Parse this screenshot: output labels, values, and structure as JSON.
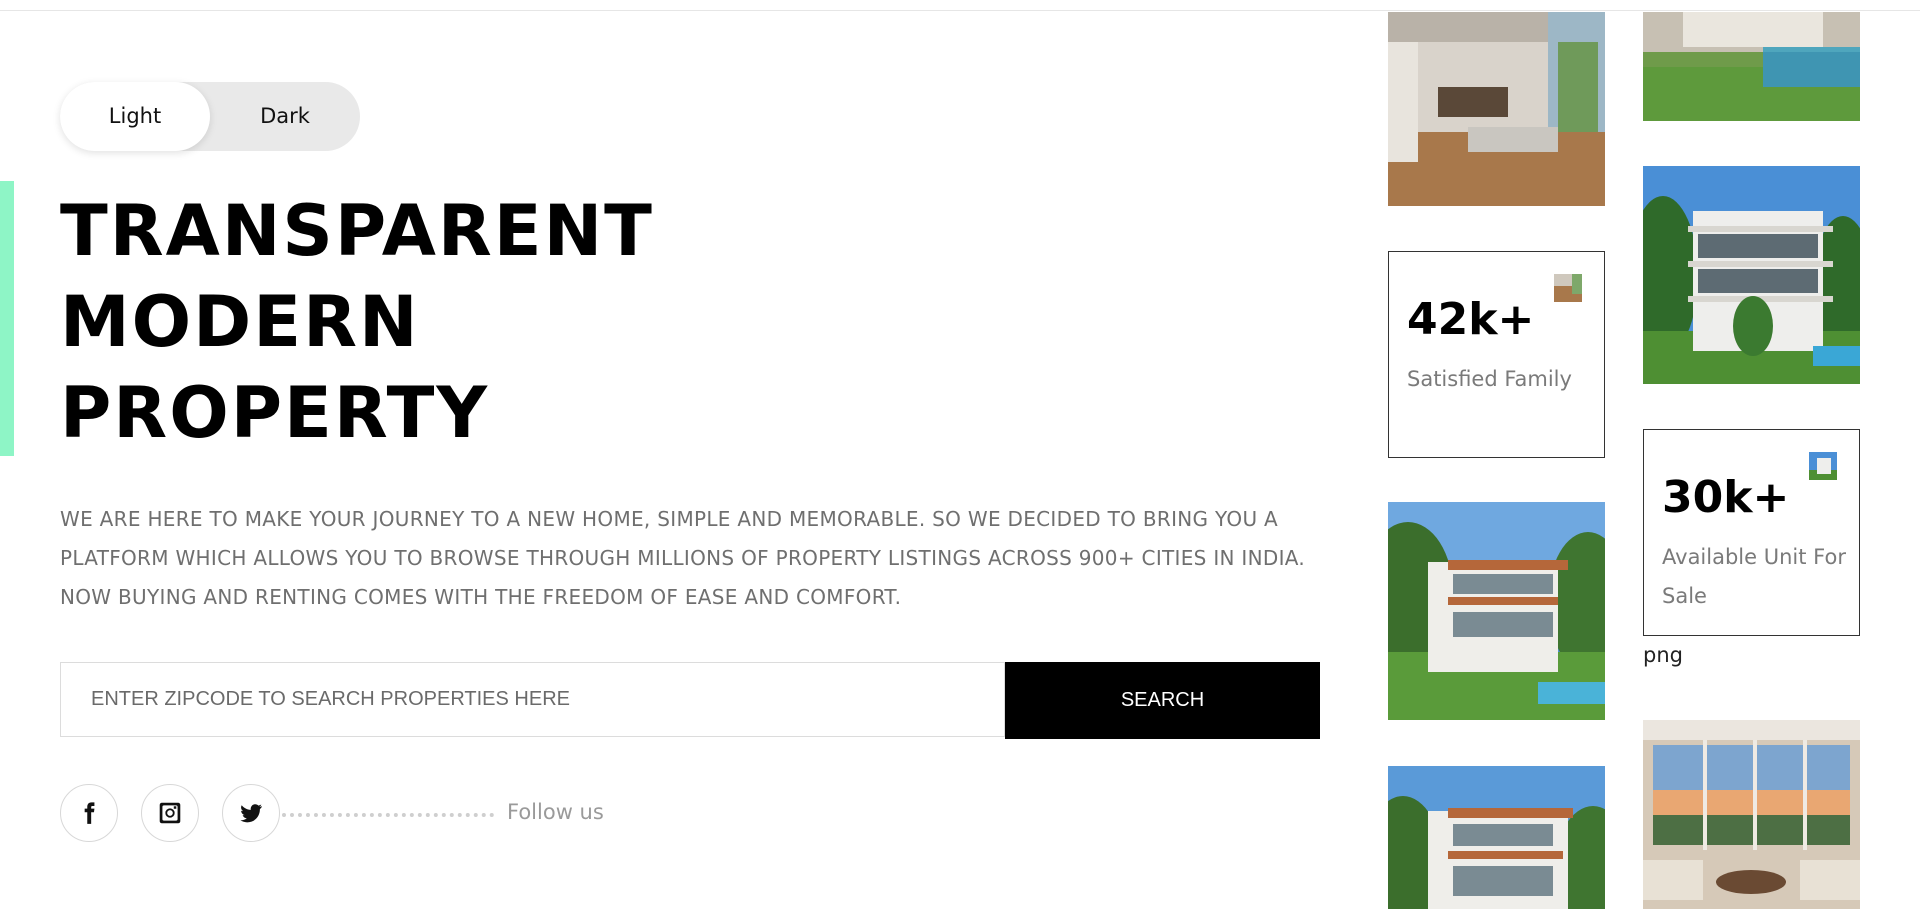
{
  "theme_toggle": {
    "light_label": "Light",
    "dark_label": "Dark",
    "active": "Light"
  },
  "hero": {
    "title_lines": [
      "TRANSPARENT",
      "MODERN",
      "PROPERTY"
    ],
    "description": "WE ARE HERE TO MAKE YOUR JOURNEY TO A NEW HOME, SIMPLE AND MEMORABLE. SO WE DECIDED TO BRING YOU A PLATFORM WHICH ALLOWS YOU TO BROWSE THROUGH MILLIONS OF PROPERTY LISTINGS ACROSS 900+ CITIES IN INDIA. NOW BUYING AND RENTING COMES WITH THE FREEDOM OF EASE AND COMFORT."
  },
  "search": {
    "placeholder": "ENTER ZIPCODE TO SEARCH PROPERTIES HERE",
    "value": "",
    "button_label": "SEARCH"
  },
  "social": {
    "icons": [
      "facebook-icon",
      "instagram-icon",
      "twitter-icon"
    ],
    "follow_label": "Follow us"
  },
  "gallery": {
    "stats": [
      {
        "number": "42k+",
        "label": "Satisfied Family"
      },
      {
        "number": "30k+",
        "label": "Available Unit For Sale"
      }
    ],
    "caption": "png"
  },
  "colors": {
    "accent": "#8ef5c6",
    "button_bg": "#000000",
    "muted_text": "#6f6f6f"
  }
}
